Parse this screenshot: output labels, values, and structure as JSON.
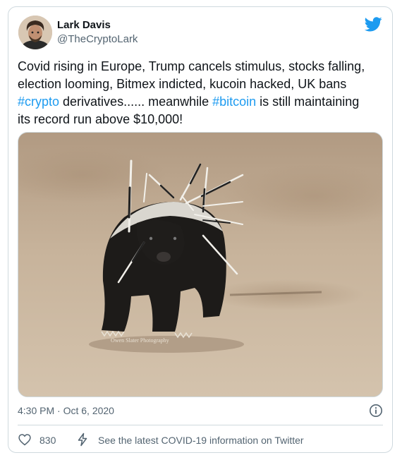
{
  "author": {
    "display_name": "Lark Davis",
    "handle": "@TheCryptoLark"
  },
  "tweet": {
    "lines": [
      [
        {
          "text": "Covid rising in Europe, Trump cancels stimulus, stocks falling,"
        }
      ],
      [
        {
          "text": "election looming, Bitmex indicted, kucoin hacked, UK bans"
        }
      ],
      [
        {
          "text": "#crypto",
          "hashtag": true
        },
        {
          "text": " derivatives...... meanwhile "
        },
        {
          "text": "#bitcoin",
          "hashtag": true
        },
        {
          "text": " is still maintaining"
        }
      ],
      [
        {
          "text": "its record run above $10,000!"
        }
      ]
    ]
  },
  "media": {
    "watermark": "Owen Slater Photography"
  },
  "meta": {
    "timestamp": "4:30 PM · Oct 6, 2020"
  },
  "actions": {
    "like_count": "830",
    "covid_link": "See the latest COVID-19 information on Twitter"
  },
  "colors": {
    "link": "#1d9bf0",
    "text": "#0f1419",
    "muted": "#536471",
    "border": "#cfd9de"
  },
  "icons": [
    "twitter-bird-icon",
    "info-icon",
    "heart-icon",
    "lightning-icon"
  ]
}
